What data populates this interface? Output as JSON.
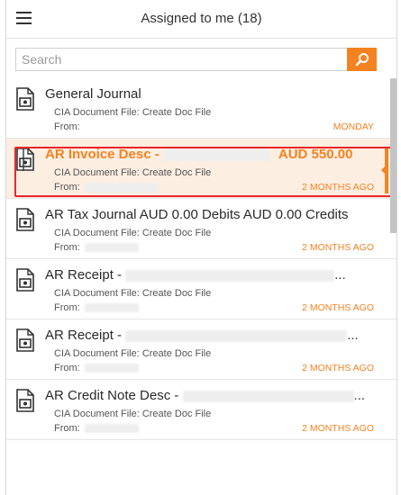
{
  "header": {
    "title": "Assigned to me (18)"
  },
  "search": {
    "placeholder": "Search"
  },
  "colors": {
    "accent": "#f58220",
    "selection_border": "#e8262a",
    "selected_bg": "#fdeee2"
  },
  "icons": {
    "menu": "hamburger-menu-icon",
    "search": "search-icon",
    "document": "document-icon"
  },
  "items": [
    {
      "name": "General Journal",
      "meta": "CIA Document File: Create Doc File",
      "from_label": "From:",
      "when": "MONDAY",
      "selected": false
    },
    {
      "name_prefix": "AR Invoice Desc - ",
      "name_suffix": "AUD 550.00",
      "meta": "CIA Document File: Create Doc File",
      "from_label": "From:",
      "when": "2 MONTHS AGO",
      "selected": true
    },
    {
      "name": "AR Tax Journal AUD 0.00 Debits AUD 0.00 Credits",
      "meta": "CIA Document File: Create Doc File",
      "from_label": "From:",
      "when": "2 MONTHS AGO",
      "selected": false
    },
    {
      "name_prefix": "AR Receipt - ",
      "name_suffix": "...",
      "meta": "CIA Document File: Create Doc File",
      "from_label": "From:",
      "when": "2 MONTHS AGO",
      "selected": false
    },
    {
      "name_prefix": "AR Receipt - ",
      "name_suffix": "...",
      "meta": "CIA Document File: Create Doc File",
      "from_label": "From:",
      "when": "2 MONTHS AGO",
      "selected": false
    },
    {
      "name_prefix": "AR Credit Note Desc - ",
      "name_suffix": "...",
      "meta": "CIA Document File: Create Doc File",
      "from_label": "From:",
      "when": "2 MONTHS AGO",
      "selected": false
    }
  ]
}
